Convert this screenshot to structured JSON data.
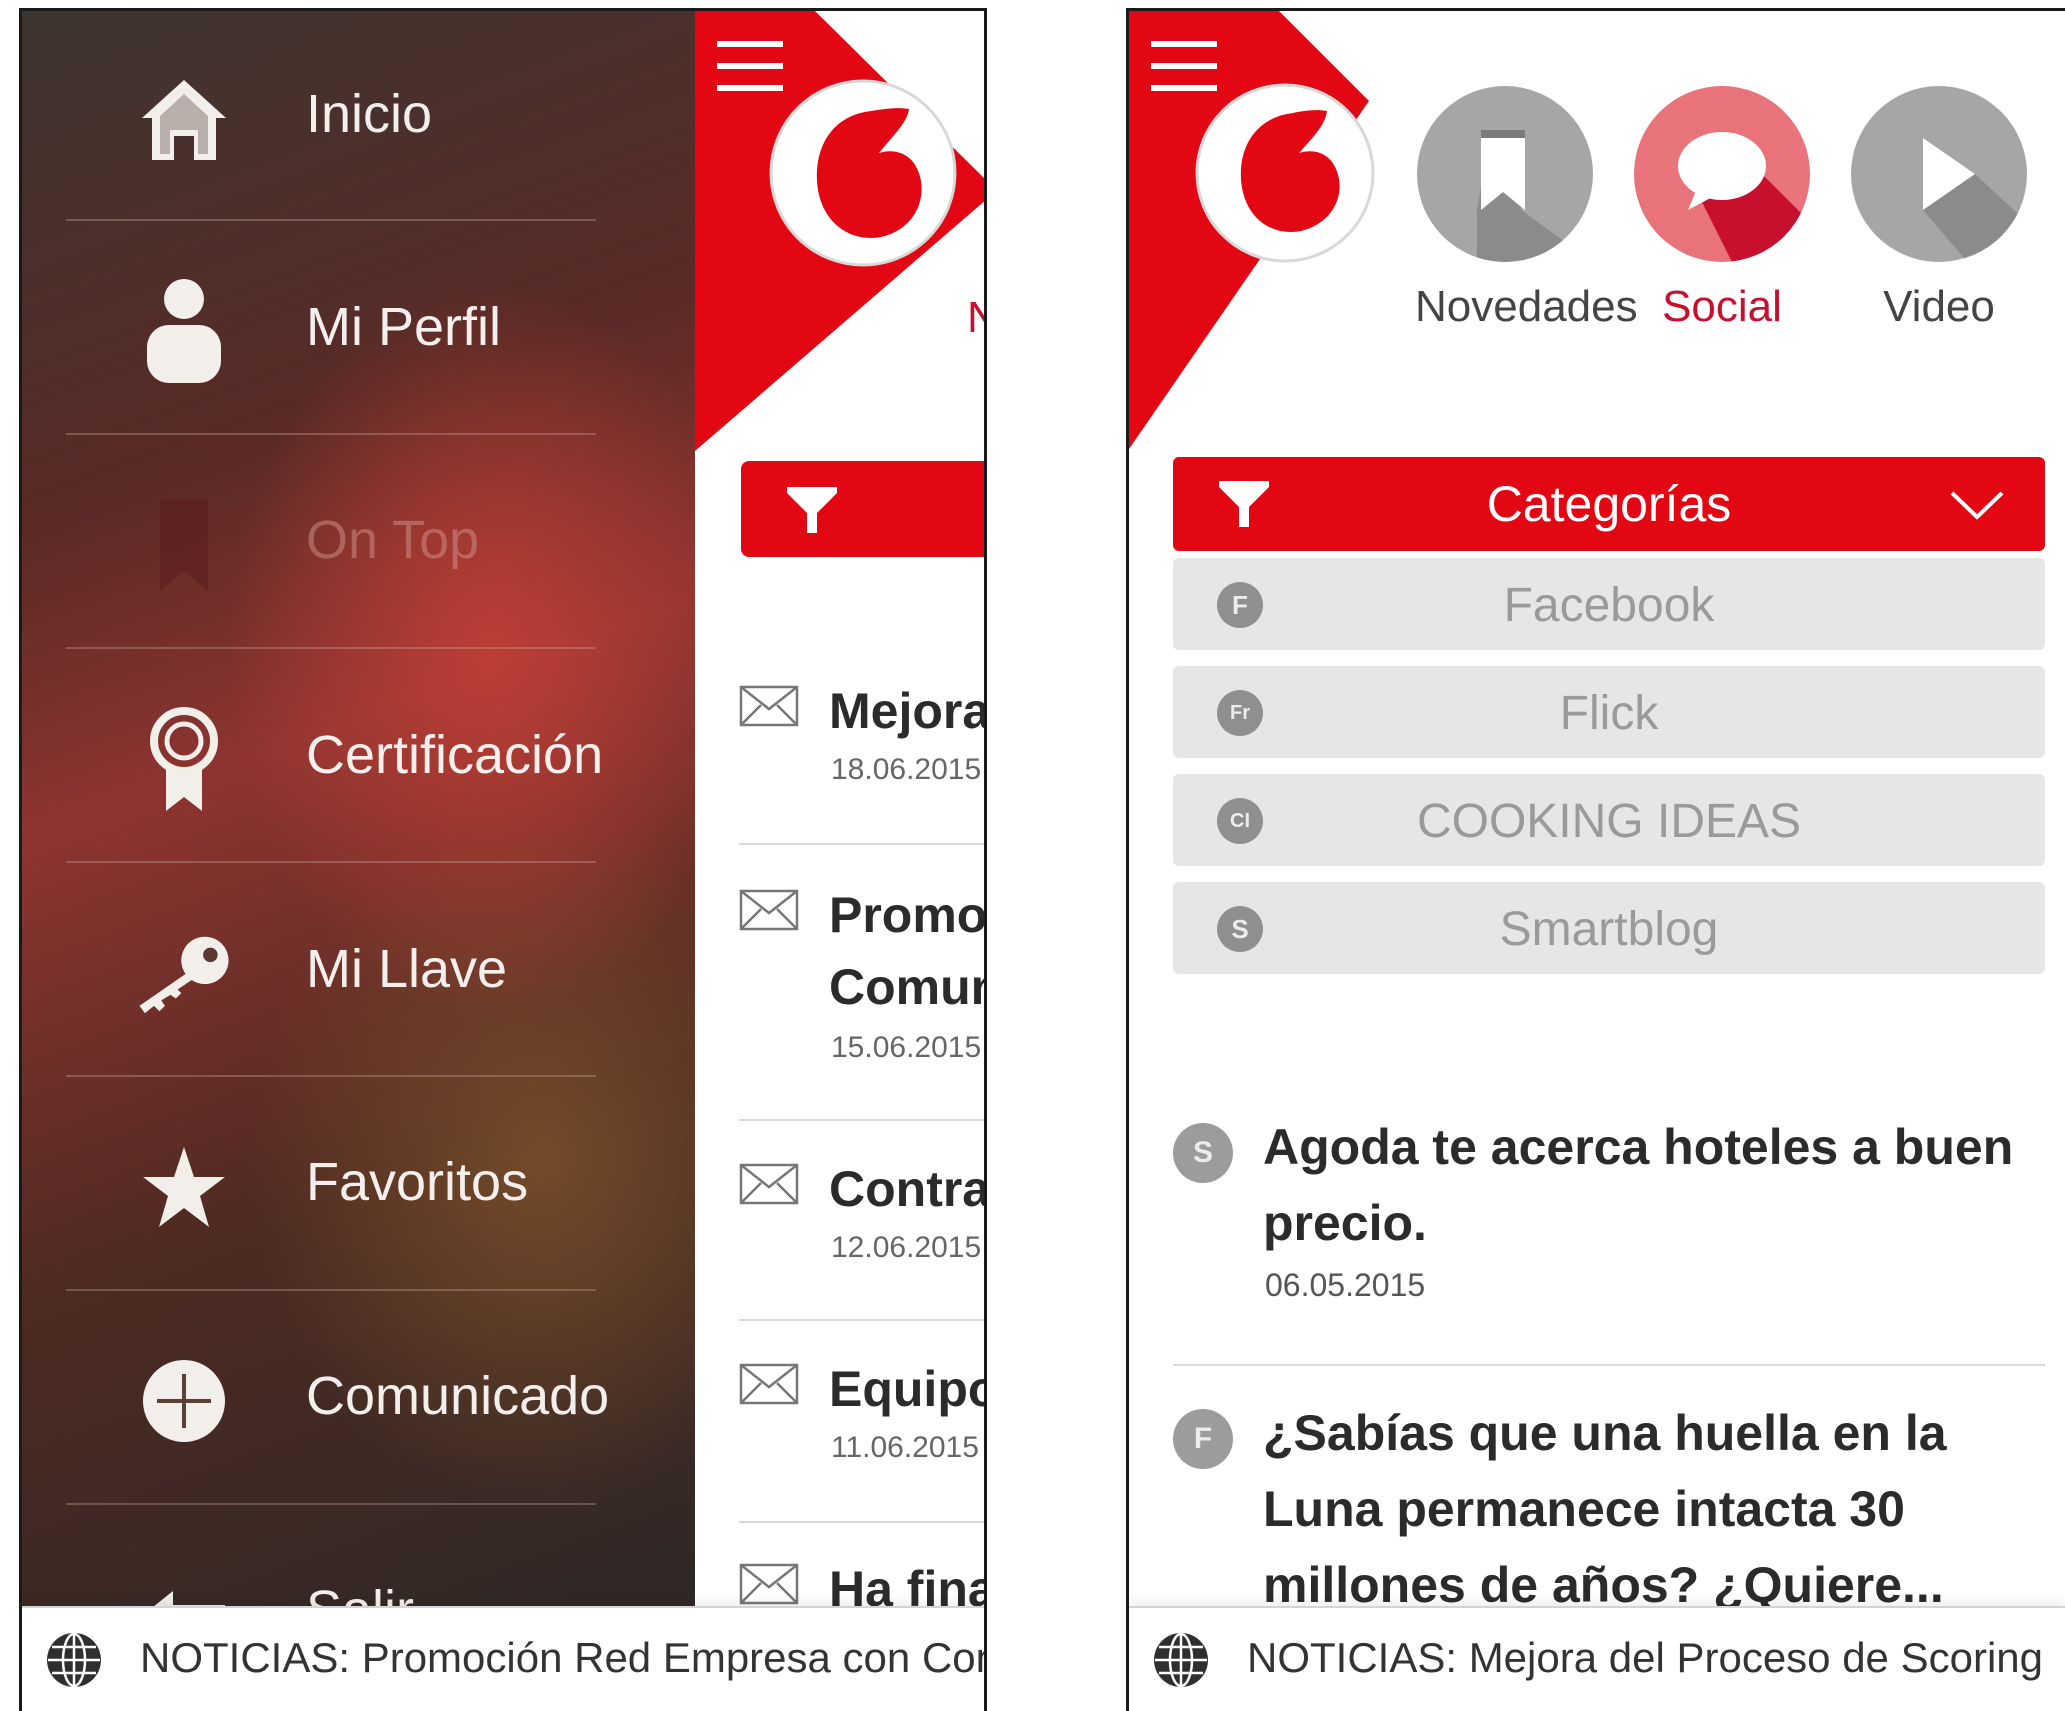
{
  "left_screen": {
    "drawer": {
      "items": [
        {
          "label": "Inicio",
          "icon": "home-icon"
        },
        {
          "label": "Mi Perfil",
          "icon": "user-icon"
        },
        {
          "label": "On Top",
          "icon": "bookmark-icon"
        },
        {
          "label": "Certificación",
          "icon": "award-ribbon-icon"
        },
        {
          "label": "Mi Llave",
          "icon": "key-icon"
        },
        {
          "label": "Favoritos",
          "icon": "star-icon"
        },
        {
          "label": "Comunicado",
          "icon": "plus-circle-icon"
        },
        {
          "label": "Salir",
          "icon": "exit-arrow-icon"
        }
      ]
    },
    "peek": {
      "tab_letter": "N",
      "messages": [
        {
          "title": "Mejora",
          "date": "18.06.2015"
        },
        {
          "title": "Promoc",
          "title2": "Comun",
          "date": "15.06.2015"
        },
        {
          "title": "Contra",
          "date": "12.06.2015"
        },
        {
          "title": "Equipo",
          "date": "11.06.2015"
        },
        {
          "title": "Ha fina"
        }
      ]
    },
    "ticker": {
      "text": "NOTICIAS: Promoción Red Empresa con Con"
    }
  },
  "right_screen": {
    "tabs": [
      {
        "label": "Novedades",
        "icon": "bookmark-icon",
        "active": false
      },
      {
        "label": "Social",
        "icon": "speech-bubble-icon",
        "active": true
      },
      {
        "label": "Video",
        "icon": "play-icon",
        "active": false
      }
    ],
    "categories": {
      "label": "Categorías",
      "options": [
        {
          "badge": "F",
          "label": "Facebook"
        },
        {
          "badge": "Fr",
          "label": "Flick"
        },
        {
          "badge": "CI",
          "label": "COOKING IDEAS"
        },
        {
          "badge": "S",
          "label": "Smartblog"
        }
      ]
    },
    "posts": [
      {
        "badge": "S",
        "title": "Agoda te acerca hoteles a buen precio.",
        "date": "06.05.2015"
      },
      {
        "badge": "F",
        "title": "¿Sabías que una huella en la Luna permanece intacta 30 millones de años? ¿Quiere..."
      }
    ],
    "ticker": {
      "text": "NOTICIAS: Mejora del Proceso de Scoring"
    }
  },
  "colors": {
    "brand_red": "#e30613",
    "active_tab_red": "#c8102e",
    "inactive_circle": "#a6a6a6",
    "active_circle": "#e8737a"
  }
}
